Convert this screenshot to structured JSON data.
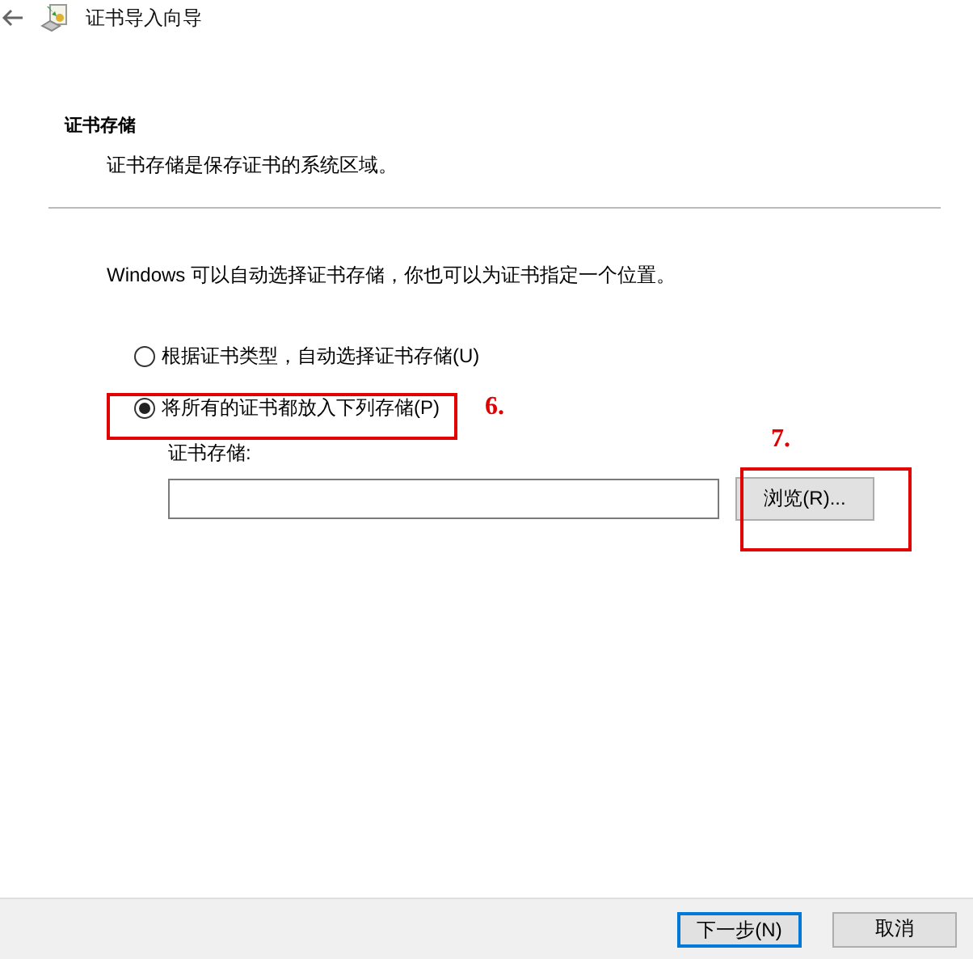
{
  "window": {
    "title": "证书导入向导"
  },
  "header": {
    "title": "证书存储",
    "description": "证书存储是保存证书的系统区域。"
  },
  "intro": "Windows 可以自动选择证书存储，你也可以为证书指定一个位置。",
  "options": [
    {
      "label": "根据证书类型，自动选择证书存储(U)",
      "selected": false
    },
    {
      "label": "将所有的证书都放入下列存储(P)",
      "selected": true
    }
  ],
  "store_field": {
    "label": "证书存储:"
  },
  "browse_button": "浏览(R)...",
  "annotations": [
    {
      "label": "6."
    },
    {
      "label": "7."
    }
  ],
  "footer_buttons": [
    {
      "label": "下一步(N)",
      "default": true
    },
    {
      "label": "取消",
      "default": false
    }
  ]
}
